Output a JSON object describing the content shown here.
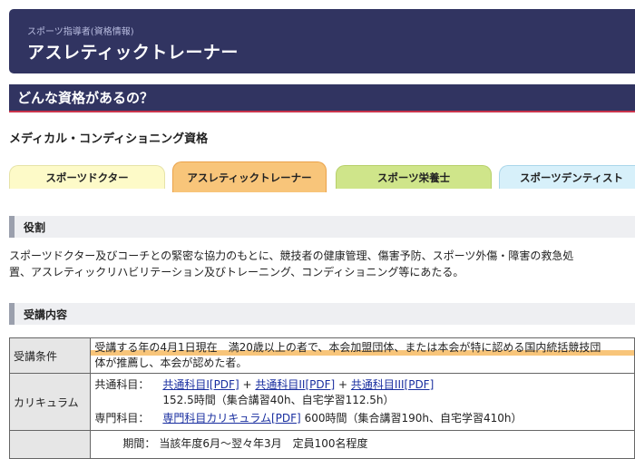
{
  "header": {
    "subtitle": "スポーツ指導者(資格情報)",
    "title": "アスレティックトレーナー"
  },
  "question": "どんな資格があるの？",
  "category": "メディカル・コンディショニング資格",
  "tabs": [
    "スポーツドクター",
    "アスレティックトレーナー",
    "スポーツ栄養士",
    "スポーツデンティスト"
  ],
  "sections": {
    "role": "役割",
    "course": "受講内容"
  },
  "role_text": [
    "スポーツドクター及びコーチとの緊密な協力のもとに、競技者の健康管理、傷害予防、スポーツ外傷・障害の救急処",
    "置、アスレティックリハビリテーション及びトレーニング、コンディショニング等にあたる。"
  ],
  "course": {
    "conditions_label": "受講条件",
    "conditions_text": [
      "受講する年の4月1日現在　満20歳以上の者で、本会加盟団体、または本会が特に認める国内統括競技団",
      "体が推薦し、本会が認めた者。"
    ],
    "curriculum_label": "カリキュラム",
    "common_label": "共通科目：",
    "common_links": [
      "共通科目I[PDF]",
      "共通科目II[PDF]",
      "共通科目III[PDF]"
    ],
    "plus": "+",
    "common_hours": "152.5時間（集合講習40h、自宅学習112.5h）",
    "special_label": "専門科目：",
    "special_link": "専門科目カリキュラム[PDF]",
    "special_hours": "600時間（集合講習190h、自宅学習410h）",
    "period_label": "期間：",
    "period_text": "当該年度6月～翌々年3月　定員100名程度"
  }
}
